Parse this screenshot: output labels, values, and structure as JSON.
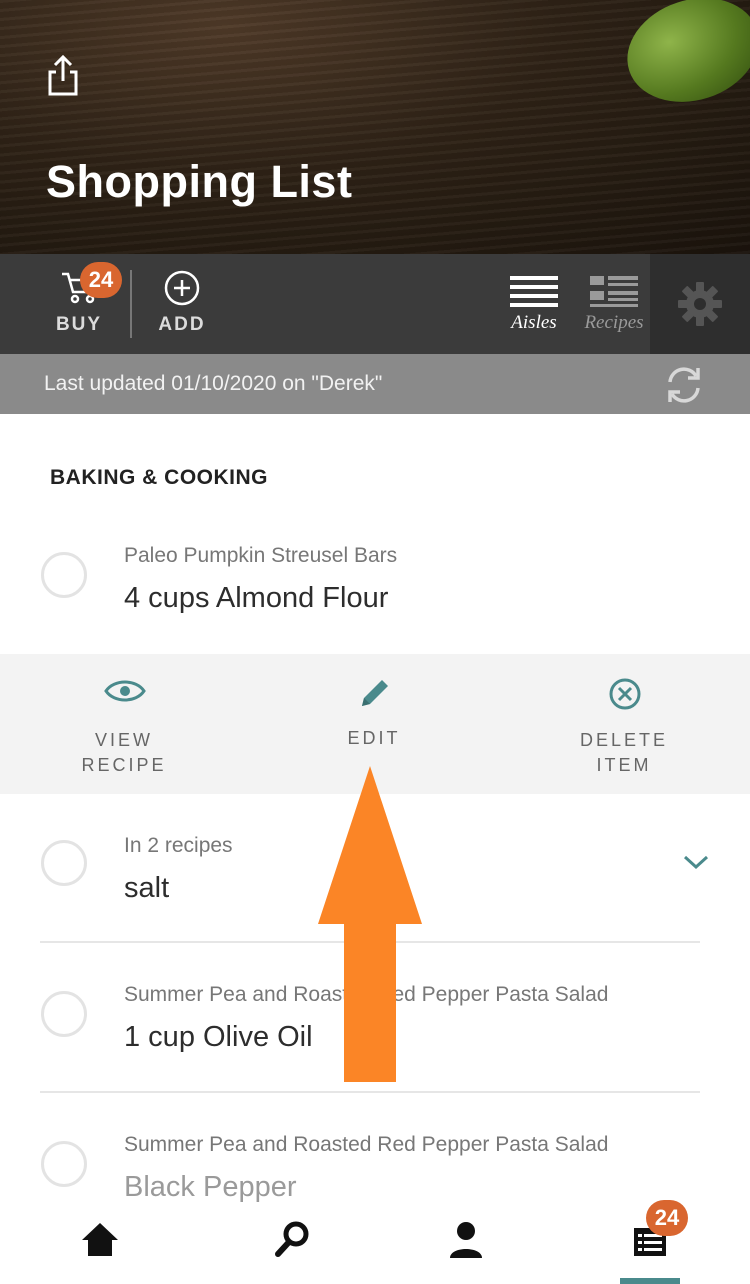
{
  "header": {
    "title": "Shopping List"
  },
  "toolbar": {
    "buy_label": "BUY",
    "buy_count": "24",
    "add_label": "ADD",
    "aisles_label": "Aisles",
    "recipes_label": "Recipes",
    "active_view": "Aisles"
  },
  "sync": {
    "text": "Last updated 01/10/2020 on \"Derek\""
  },
  "section": {
    "title": "BAKING & COOKING"
  },
  "items": [
    {
      "source": "Paleo Pumpkin Streusel Bars",
      "name": "4 cups Almond Flour",
      "checked": false
    },
    {
      "source": "In 2 recipes",
      "name": "salt",
      "checked": false,
      "expandable": true
    },
    {
      "source": "Summer Pea and Roasted Red Pepper Pasta Salad",
      "name": "1 cup Olive Oil",
      "checked": false
    },
    {
      "source": "Summer Pea and Roasted Red Pepper Pasta Salad",
      "name": "Black Pepper",
      "checked": false
    }
  ],
  "actions": {
    "view_recipe": [
      "VIEW",
      "RECIPE"
    ],
    "edit": "EDIT",
    "delete_item": [
      "DELETE",
      "ITEM"
    ]
  },
  "bottom_nav": {
    "items": [
      "home-icon",
      "search-icon",
      "profile-icon",
      "list-icon"
    ],
    "list_count": "24",
    "active": "list-icon"
  },
  "colors": {
    "accent": "#4a8a8c",
    "badge": "#d9662f",
    "toolbar": "#3b3b3b",
    "sync_bar": "#8a8a8a",
    "arrow": "#fb8526"
  }
}
